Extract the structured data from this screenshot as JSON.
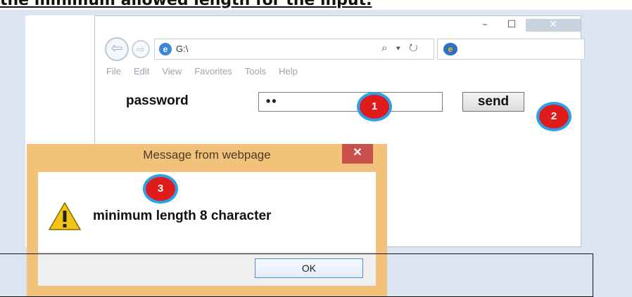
{
  "heading": "the minimum allowed length for the input.",
  "browser": {
    "window_controls": {
      "minimize": "–",
      "maximize": "☐",
      "close": "✕"
    },
    "nav": {
      "back_glyph": "⇦",
      "forward_glyph": "⇨"
    },
    "address": "G:\\",
    "address_controls": "⌕ ▾ ↻",
    "ie_glyph": "e",
    "menu": [
      "File",
      "Edit",
      "View",
      "Favorites",
      "Tools",
      "Help"
    ]
  },
  "form": {
    "password_label": "password",
    "password_value": "••",
    "send_label": "send"
  },
  "markers": [
    "1",
    "2",
    "3"
  ],
  "dialog": {
    "title": "Message from webpage",
    "close_glyph": "✕",
    "message": "minimum length 8 character",
    "ok_label": "OK"
  },
  "colors": {
    "marker_fill": "#e01b1b",
    "marker_ring": "#2ea0e8",
    "dialog_frame": "#f2c17a",
    "dialog_close": "#c9504c",
    "page_background": "#dbe5f1"
  },
  "icons": [
    "back-arrow-icon",
    "forward-arrow-icon",
    "ie-page-icon",
    "search-icon",
    "refresh-icon",
    "ie-tab-icon",
    "warning-icon",
    "close-icon"
  ]
}
